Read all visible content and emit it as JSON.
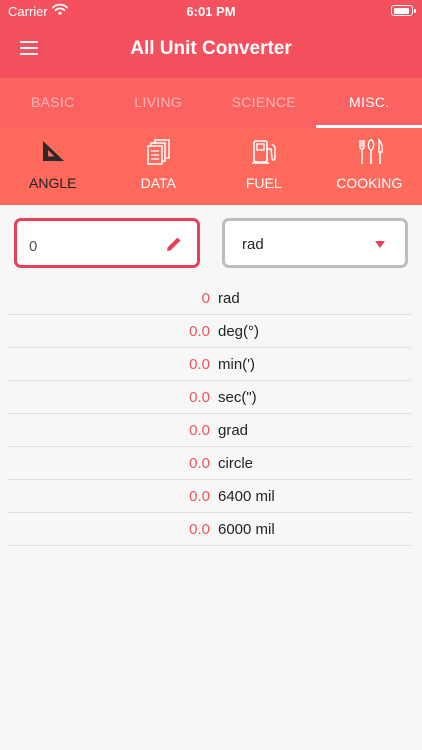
{
  "status_bar": {
    "carrier": "Carrier",
    "time": "6:01 PM"
  },
  "header": {
    "title": "All Unit Converter"
  },
  "tabs": [
    {
      "label": "BASIC"
    },
    {
      "label": "LIVING"
    },
    {
      "label": "SCIENCE"
    },
    {
      "label": "MISC."
    }
  ],
  "active_tab": "MISC.",
  "categories": [
    {
      "label": "ANGLE",
      "icon": "set-square-icon"
    },
    {
      "label": "DATA",
      "icon": "documents-icon"
    },
    {
      "label": "FUEL",
      "icon": "fuel-pump-icon"
    },
    {
      "label": "COOKING",
      "icon": "utensils-icon"
    }
  ],
  "active_category": "ANGLE",
  "input": {
    "value": "0"
  },
  "unit_select": {
    "selected": "rad"
  },
  "results": [
    {
      "value": "0",
      "unit": "rad"
    },
    {
      "value": "0.0",
      "unit": "deg(°)"
    },
    {
      "value": "0.0",
      "unit": "min(')"
    },
    {
      "value": "0.0",
      "unit": "sec(\")"
    },
    {
      "value": "0.0",
      "unit": "grad"
    },
    {
      "value": "0.0",
      "unit": "circle"
    },
    {
      "value": "0.0",
      "unit": "6400 mil"
    },
    {
      "value": "0.0",
      "unit": "6000 mil"
    }
  ],
  "colors": {
    "header": "#f4505e",
    "tabs": "#fb6262",
    "categories": "#ff6a5c",
    "accent": "#e8405a"
  }
}
